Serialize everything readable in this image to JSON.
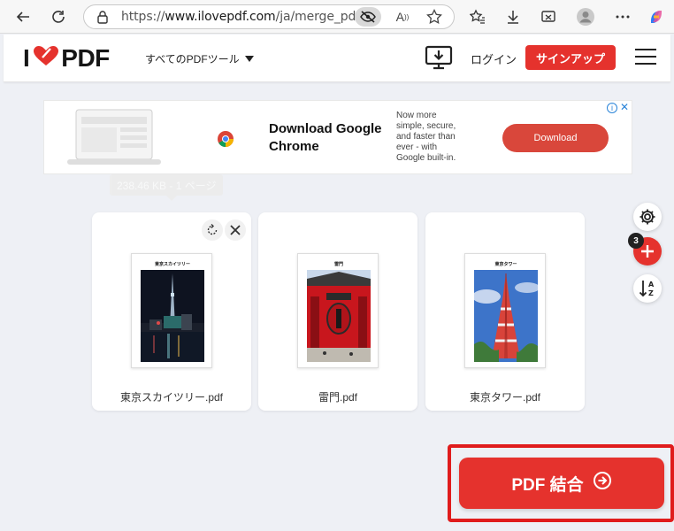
{
  "browser": {
    "url_prefix": "https://",
    "url_host": "www.ilovepdf.com",
    "url_path": "/ja/merge_pdf",
    "read_aloud_label": "A"
  },
  "header": {
    "logo_left": "I",
    "logo_right": "PDF",
    "tools_menu_label": "すべてのPDFツール",
    "login_label": "ログイン",
    "signup_label": "サインアップ"
  },
  "ad": {
    "title": "Download Google Chrome",
    "description": "Now more simple, secure, and faster than ever - with Google built-in.",
    "button_label": "Download",
    "info_label": "i",
    "close_label": "✕"
  },
  "tooltip": {
    "text": "238.46 KB - 1 ページ"
  },
  "files": [
    {
      "name": "東京スカイツリー.pdf",
      "page_title": "東京スカイツリー"
    },
    {
      "name": "雷門.pdf",
      "page_title": "雷門"
    },
    {
      "name": "東京タワー.pdf",
      "page_title": "東京タワー"
    }
  ],
  "side_tools": {
    "file_count": "3"
  },
  "merge": {
    "label": "PDF 結合"
  },
  "colors": {
    "brand_red": "#e5322d",
    "highlight_red": "#e01c1c"
  }
}
